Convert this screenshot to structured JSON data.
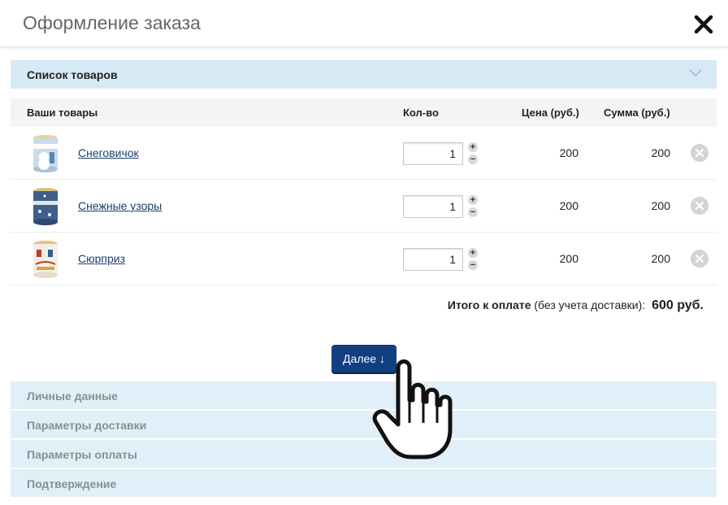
{
  "header": {
    "title": "Оформление заказа"
  },
  "cart_section": {
    "title": "Список товаров"
  },
  "table": {
    "columns": {
      "product": "Ваши товары",
      "qty": "Кол-во",
      "price": "Цена (руб.)",
      "sum": "Сумма (руб.)"
    },
    "rows": [
      {
        "name": "Снеговичок",
        "qty": "1",
        "price": "200",
        "sum": "200"
      },
      {
        "name": "Снежные узоры",
        "qty": "1",
        "price": "200",
        "sum": "200"
      },
      {
        "name": "Сюрприз",
        "qty": "1",
        "price": "200",
        "sum": "200"
      }
    ],
    "stepper": {
      "plus": "+",
      "minus": "−"
    }
  },
  "total": {
    "label": "Итого к оплате",
    "note": "(без учета доставки):",
    "amount": "600 руб."
  },
  "next_button": {
    "label": "Далее ↓"
  },
  "steps": [
    {
      "label": "Личные данные"
    },
    {
      "label": "Параметры доставки"
    },
    {
      "label": "Параметры оплаты"
    },
    {
      "label": "Подтверждение"
    }
  ],
  "colors": {
    "accent": "#123f7f",
    "section_active_bg": "#d6eaf6",
    "section_collapsed_bg": "#e1eff8",
    "link": "#1c3d6a"
  },
  "icons": {
    "close": "close-icon",
    "collapse": "chevron-down-icon",
    "remove": "remove-icon",
    "cursor": "hand-pointer-icon"
  }
}
